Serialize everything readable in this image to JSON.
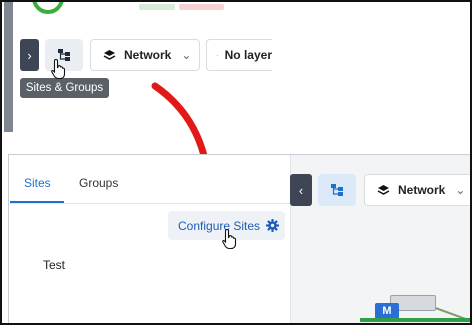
{
  "top": {
    "tooltip": "Sites & Groups",
    "network_label": "Network",
    "layer_label": "No layer"
  },
  "panel": {
    "tabs": [
      {
        "label": "Sites"
      },
      {
        "label": "Groups"
      }
    ],
    "configure_label": "Configure Sites",
    "sites": [
      {
        "label": "Test"
      }
    ]
  },
  "map": {
    "network_label": "Network",
    "device_badge": "M"
  },
  "colors": {
    "accent": "#1f6fd1",
    "arrow": "#e11919",
    "dark_button": "#3e4656",
    "status_green": "#3cae3c"
  },
  "icons": {
    "expand": "chevron-right-icon",
    "collapse": "chevron-left-icon",
    "tree": "site-tree-icon",
    "layers": "layers-icon",
    "dropdown": "chevron-down-icon",
    "layer_box": "layer-box-icon",
    "gear": "gear-icon",
    "cursor": "hand-cursor-icon",
    "arrow": "red-curved-arrow-icon"
  }
}
